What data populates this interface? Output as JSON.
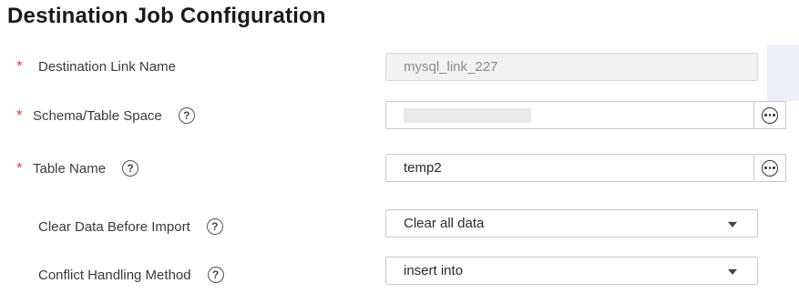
{
  "title": "Destination Job Configuration",
  "colors": {
    "required_asterisk": "#e8453c",
    "disabled_field_bg": "#f2f2f2",
    "border": "#c9c9c9"
  },
  "fields": [
    {
      "label": "Destination Link Name",
      "required": true,
      "help": false,
      "type": "text-disabled",
      "value": "mysql_link_227"
    },
    {
      "label": "Schema/Table Space",
      "required": true,
      "help": true,
      "type": "text-with-browse",
      "value": "",
      "value_redacted": true,
      "browse_icon": "ellipsis-circle-icon"
    },
    {
      "label": "Table Name",
      "required": true,
      "help": true,
      "type": "text-with-browse",
      "value": "temp2",
      "browse_icon": "ellipsis-circle-icon"
    },
    {
      "label": "Clear Data Before Import",
      "required": false,
      "help": true,
      "type": "select",
      "value": "Clear all data"
    },
    {
      "label": "Conflict Handling Method",
      "required": false,
      "help": true,
      "type": "select",
      "value": "insert into"
    }
  ],
  "help_glyph": "?",
  "required_glyph": "*"
}
